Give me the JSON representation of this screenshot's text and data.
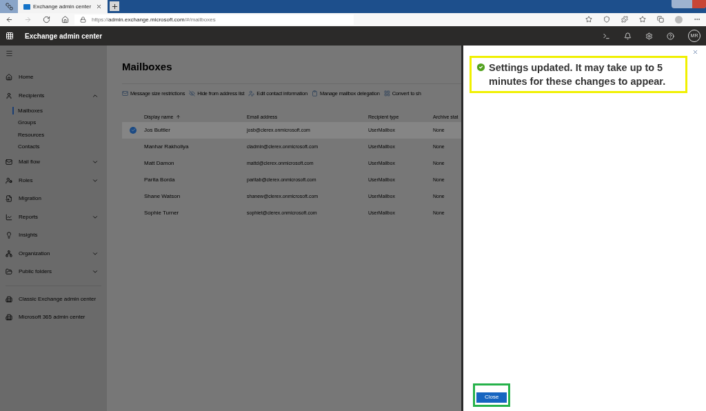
{
  "browser": {
    "tab_title": "Exchange admin center",
    "url_prefix": "https://",
    "url_host": "admin.exchange.microsoft.com",
    "url_path": "/#/mailboxes"
  },
  "app_header": {
    "title": "Exchange admin center",
    "avatar": "MR"
  },
  "sidebar": {
    "items": [
      {
        "label": "Home"
      },
      {
        "label": "Recipients",
        "expandable": true,
        "expanded": true,
        "children": [
          {
            "label": "Mailboxes",
            "selected": true
          },
          {
            "label": "Groups",
            "selected": false
          },
          {
            "label": "Resources",
            "selected": false
          },
          {
            "label": "Contacts",
            "selected": false
          }
        ]
      },
      {
        "label": "Mail flow",
        "expandable": true,
        "expanded": false
      },
      {
        "label": "Roles",
        "expandable": true,
        "expanded": false
      },
      {
        "label": "Migration"
      },
      {
        "label": "Reports",
        "expandable": true,
        "expanded": false
      },
      {
        "label": "Insights"
      },
      {
        "label": "Organization",
        "expandable": true,
        "expanded": false
      },
      {
        "label": "Public folders",
        "expandable": true,
        "expanded": false
      }
    ],
    "links": [
      {
        "label": "Classic Exchange admin center"
      },
      {
        "label": "Microsoft 365 admin center"
      }
    ]
  },
  "page": {
    "title": "Mailboxes",
    "toolbar": [
      "Message size restrictions",
      "Hide from address list",
      "Edit contact information",
      "Manage mailbox delegation",
      "Convert to sh"
    ],
    "table": {
      "columns": [
        "Display name",
        "Email address",
        "Recipient type",
        "Archive stat"
      ],
      "rows": [
        {
          "selected": true,
          "cells": [
            "Jos Buttler",
            "josb@clerex.onmicrosoft.com",
            "UserMailbox",
            "None"
          ]
        },
        {
          "selected": false,
          "cells": [
            "Manhar Rakholiya",
            "cladmin@clerex.onmicrosoft.com",
            "UserMailbox",
            "None"
          ]
        },
        {
          "selected": false,
          "cells": [
            "Matt Damon",
            "mattd@clerex.onmicrosoft.com",
            "UserMailbox",
            "None"
          ]
        },
        {
          "selected": false,
          "cells": [
            "Parita Borda",
            "paritab@clerex.onmicrosoft.com",
            "UserMailbox",
            "None"
          ]
        },
        {
          "selected": false,
          "cells": [
            "Shane Watson",
            "shanew@clerex.onmicrosoft.com",
            "UserMailbox",
            "None"
          ]
        },
        {
          "selected": false,
          "cells": [
            "Sophie Turner",
            "sophiet@clerex.onmicrosoft.com",
            "UserMailbox",
            "None"
          ]
        }
      ]
    }
  },
  "panel": {
    "message": "Settings updated. It may take up to 5 minutes for these changes to appear.",
    "close_button": "Close"
  }
}
